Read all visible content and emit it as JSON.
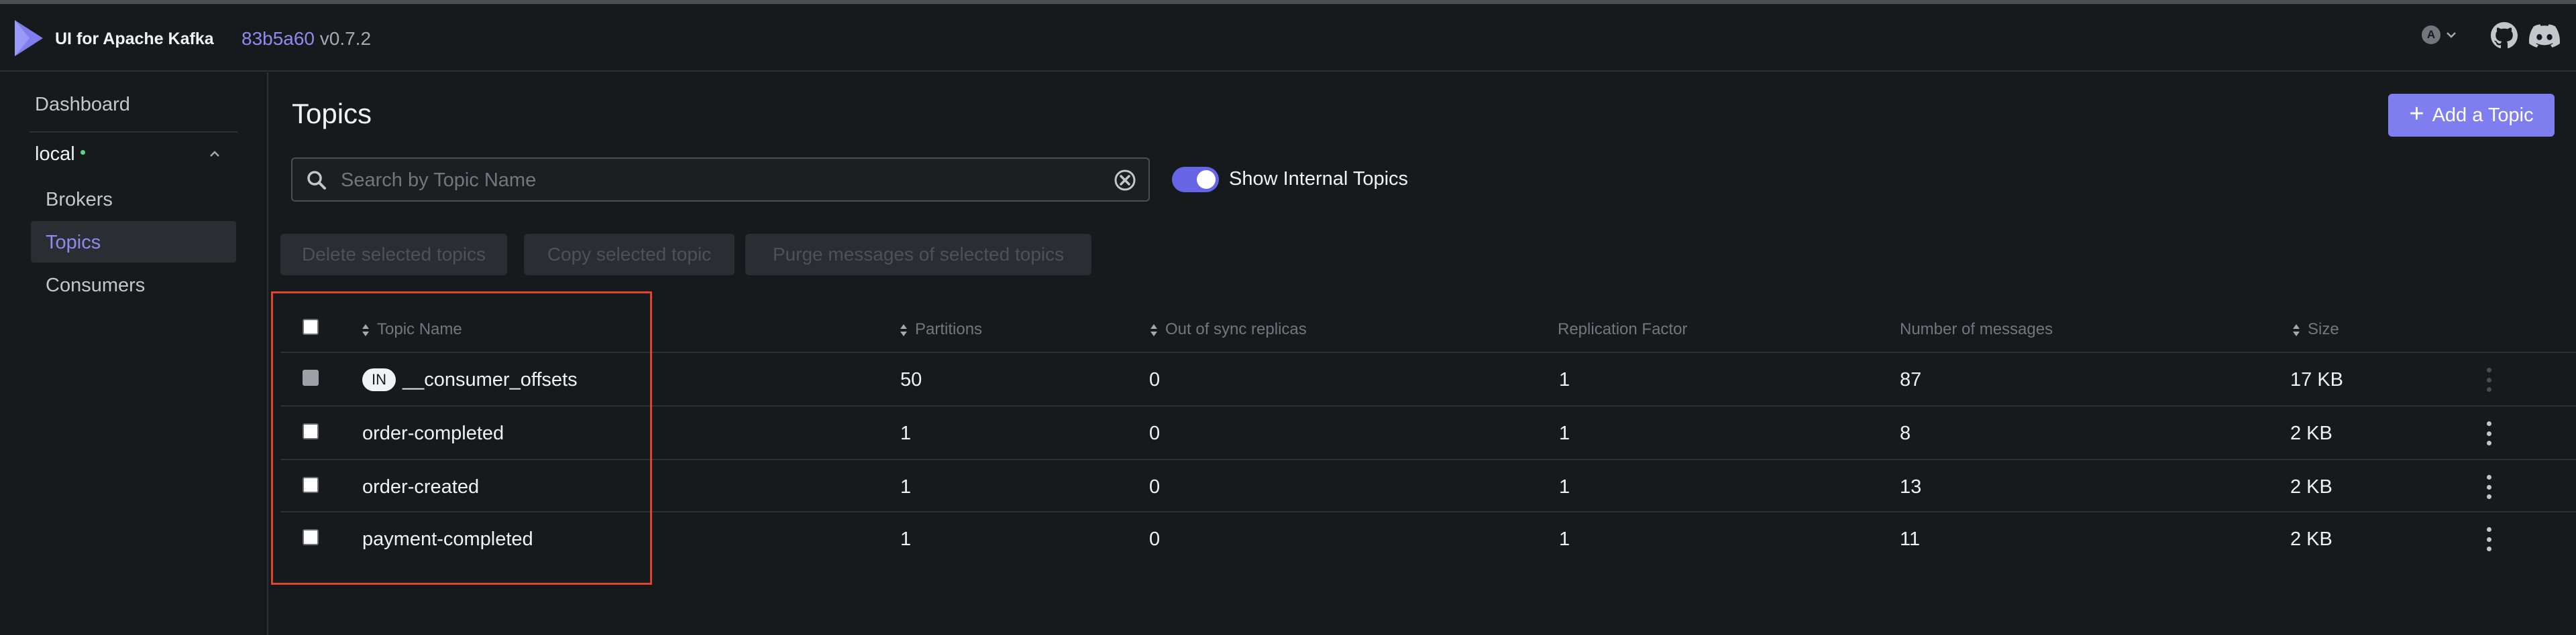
{
  "navbar": {
    "app_title": "UI for Apache Kafka",
    "version_hash": "83b5a60",
    "version": "v0.7.2",
    "user_initial": "A",
    "icons": [
      "logo-icon",
      "chevron-down-icon",
      "github-icon",
      "discord-icon"
    ]
  },
  "sidebar": {
    "dashboard": "Dashboard",
    "cluster": "local",
    "items": [
      {
        "label": "Brokers"
      },
      {
        "label": "Topics"
      },
      {
        "label": "Consumers"
      }
    ]
  },
  "main": {
    "title": "Topics",
    "add_button": "Add a Topic",
    "search_placeholder": "Search by Topic Name",
    "show_internal_label": "Show Internal Topics",
    "show_internal_on": true,
    "bulk_actions": {
      "delete": "Delete selected topics",
      "copy": "Copy selected topic",
      "purge": "Purge messages of selected topics"
    },
    "columns": {
      "name": "Topic Name",
      "partitions": "Partitions",
      "out_of_sync": "Out of sync replicas",
      "replication_factor": "Replication Factor",
      "messages": "Number of messages",
      "size": "Size"
    },
    "rows": [
      {
        "internal_badge": "IN",
        "name": "__consumer_offsets",
        "partitions": "50",
        "out_of_sync": "0",
        "replication_factor": "1",
        "messages": "87",
        "size": "17 KB"
      },
      {
        "name": "order-completed",
        "partitions": "1",
        "out_of_sync": "0",
        "replication_factor": "1",
        "messages": "8",
        "size": "2 KB"
      },
      {
        "name": "order-created",
        "partitions": "1",
        "out_of_sync": "0",
        "replication_factor": "1",
        "messages": "13",
        "size": "2 KB"
      },
      {
        "name": "payment-completed",
        "partitions": "1",
        "out_of_sync": "0",
        "replication_factor": "1",
        "messages": "11",
        "size": "2 KB"
      }
    ]
  },
  "colors": {
    "accent": "#7f7ef0",
    "background": "#171a1c",
    "highlight": "#e0442a",
    "cluster_online": "#5cd685"
  }
}
